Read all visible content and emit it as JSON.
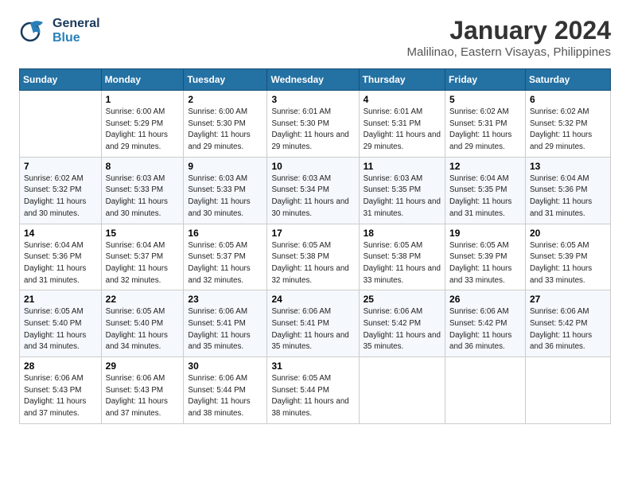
{
  "header": {
    "logo_general": "General",
    "logo_blue": "Blue",
    "title": "January 2024",
    "subtitle": "Malilinao, Eastern Visayas, Philippines"
  },
  "columns": [
    "Sunday",
    "Monday",
    "Tuesday",
    "Wednesday",
    "Thursday",
    "Friday",
    "Saturday"
  ],
  "weeks": [
    [
      {
        "day": "",
        "sunrise": "",
        "sunset": "",
        "daylight": ""
      },
      {
        "day": "1",
        "sunrise": "Sunrise: 6:00 AM",
        "sunset": "Sunset: 5:29 PM",
        "daylight": "Daylight: 11 hours and 29 minutes."
      },
      {
        "day": "2",
        "sunrise": "Sunrise: 6:00 AM",
        "sunset": "Sunset: 5:30 PM",
        "daylight": "Daylight: 11 hours and 29 minutes."
      },
      {
        "day": "3",
        "sunrise": "Sunrise: 6:01 AM",
        "sunset": "Sunset: 5:30 PM",
        "daylight": "Daylight: 11 hours and 29 minutes."
      },
      {
        "day": "4",
        "sunrise": "Sunrise: 6:01 AM",
        "sunset": "Sunset: 5:31 PM",
        "daylight": "Daylight: 11 hours and 29 minutes."
      },
      {
        "day": "5",
        "sunrise": "Sunrise: 6:02 AM",
        "sunset": "Sunset: 5:31 PM",
        "daylight": "Daylight: 11 hours and 29 minutes."
      },
      {
        "day": "6",
        "sunrise": "Sunrise: 6:02 AM",
        "sunset": "Sunset: 5:32 PM",
        "daylight": "Daylight: 11 hours and 29 minutes."
      }
    ],
    [
      {
        "day": "7",
        "sunrise": "Sunrise: 6:02 AM",
        "sunset": "Sunset: 5:32 PM",
        "daylight": "Daylight: 11 hours and 30 minutes."
      },
      {
        "day": "8",
        "sunrise": "Sunrise: 6:03 AM",
        "sunset": "Sunset: 5:33 PM",
        "daylight": "Daylight: 11 hours and 30 minutes."
      },
      {
        "day": "9",
        "sunrise": "Sunrise: 6:03 AM",
        "sunset": "Sunset: 5:33 PM",
        "daylight": "Daylight: 11 hours and 30 minutes."
      },
      {
        "day": "10",
        "sunrise": "Sunrise: 6:03 AM",
        "sunset": "Sunset: 5:34 PM",
        "daylight": "Daylight: 11 hours and 30 minutes."
      },
      {
        "day": "11",
        "sunrise": "Sunrise: 6:03 AM",
        "sunset": "Sunset: 5:35 PM",
        "daylight": "Daylight: 11 hours and 31 minutes."
      },
      {
        "day": "12",
        "sunrise": "Sunrise: 6:04 AM",
        "sunset": "Sunset: 5:35 PM",
        "daylight": "Daylight: 11 hours and 31 minutes."
      },
      {
        "day": "13",
        "sunrise": "Sunrise: 6:04 AM",
        "sunset": "Sunset: 5:36 PM",
        "daylight": "Daylight: 11 hours and 31 minutes."
      }
    ],
    [
      {
        "day": "14",
        "sunrise": "Sunrise: 6:04 AM",
        "sunset": "Sunset: 5:36 PM",
        "daylight": "Daylight: 11 hours and 31 minutes."
      },
      {
        "day": "15",
        "sunrise": "Sunrise: 6:04 AM",
        "sunset": "Sunset: 5:37 PM",
        "daylight": "Daylight: 11 hours and 32 minutes."
      },
      {
        "day": "16",
        "sunrise": "Sunrise: 6:05 AM",
        "sunset": "Sunset: 5:37 PM",
        "daylight": "Daylight: 11 hours and 32 minutes."
      },
      {
        "day": "17",
        "sunrise": "Sunrise: 6:05 AM",
        "sunset": "Sunset: 5:38 PM",
        "daylight": "Daylight: 11 hours and 32 minutes."
      },
      {
        "day": "18",
        "sunrise": "Sunrise: 6:05 AM",
        "sunset": "Sunset: 5:38 PM",
        "daylight": "Daylight: 11 hours and 33 minutes."
      },
      {
        "day": "19",
        "sunrise": "Sunrise: 6:05 AM",
        "sunset": "Sunset: 5:39 PM",
        "daylight": "Daylight: 11 hours and 33 minutes."
      },
      {
        "day": "20",
        "sunrise": "Sunrise: 6:05 AM",
        "sunset": "Sunset: 5:39 PM",
        "daylight": "Daylight: 11 hours and 33 minutes."
      }
    ],
    [
      {
        "day": "21",
        "sunrise": "Sunrise: 6:05 AM",
        "sunset": "Sunset: 5:40 PM",
        "daylight": "Daylight: 11 hours and 34 minutes."
      },
      {
        "day": "22",
        "sunrise": "Sunrise: 6:05 AM",
        "sunset": "Sunset: 5:40 PM",
        "daylight": "Daylight: 11 hours and 34 minutes."
      },
      {
        "day": "23",
        "sunrise": "Sunrise: 6:06 AM",
        "sunset": "Sunset: 5:41 PM",
        "daylight": "Daylight: 11 hours and 35 minutes."
      },
      {
        "day": "24",
        "sunrise": "Sunrise: 6:06 AM",
        "sunset": "Sunset: 5:41 PM",
        "daylight": "Daylight: 11 hours and 35 minutes."
      },
      {
        "day": "25",
        "sunrise": "Sunrise: 6:06 AM",
        "sunset": "Sunset: 5:42 PM",
        "daylight": "Daylight: 11 hours and 35 minutes."
      },
      {
        "day": "26",
        "sunrise": "Sunrise: 6:06 AM",
        "sunset": "Sunset: 5:42 PM",
        "daylight": "Daylight: 11 hours and 36 minutes."
      },
      {
        "day": "27",
        "sunrise": "Sunrise: 6:06 AM",
        "sunset": "Sunset: 5:42 PM",
        "daylight": "Daylight: 11 hours and 36 minutes."
      }
    ],
    [
      {
        "day": "28",
        "sunrise": "Sunrise: 6:06 AM",
        "sunset": "Sunset: 5:43 PM",
        "daylight": "Daylight: 11 hours and 37 minutes."
      },
      {
        "day": "29",
        "sunrise": "Sunrise: 6:06 AM",
        "sunset": "Sunset: 5:43 PM",
        "daylight": "Daylight: 11 hours and 37 minutes."
      },
      {
        "day": "30",
        "sunrise": "Sunrise: 6:06 AM",
        "sunset": "Sunset: 5:44 PM",
        "daylight": "Daylight: 11 hours and 38 minutes."
      },
      {
        "day": "31",
        "sunrise": "Sunrise: 6:05 AM",
        "sunset": "Sunset: 5:44 PM",
        "daylight": "Daylight: 11 hours and 38 minutes."
      },
      {
        "day": "",
        "sunrise": "",
        "sunset": "",
        "daylight": ""
      },
      {
        "day": "",
        "sunrise": "",
        "sunset": "",
        "daylight": ""
      },
      {
        "day": "",
        "sunrise": "",
        "sunset": "",
        "daylight": ""
      }
    ]
  ]
}
